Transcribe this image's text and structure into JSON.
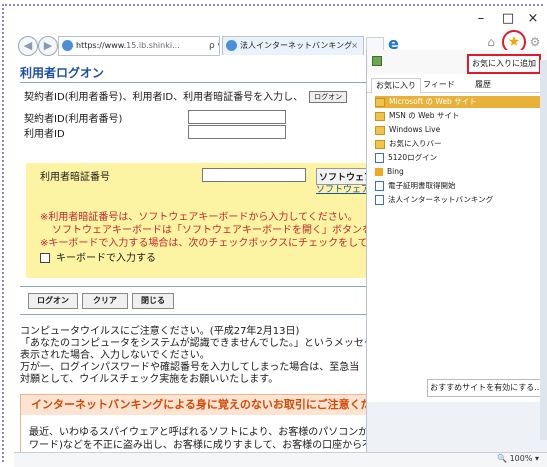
{
  "browser": {
    "url_host": "https://www.",
    "url_rest": "15.ib.shinki...",
    "url_icons": "ρ ▾ 🔒 C",
    "tab_title": "法人インターネットバンキング",
    "tab_close": "×",
    "ie_letter": "e",
    "win_minimize": "–",
    "win_maximize": "□",
    "win_close": "×",
    "star": "★",
    "zoom": "🔍 100%  ▾"
  },
  "page": {
    "title": "利用者ログオン",
    "instruction": "契約者ID(利用者番号)、利用者ID、利用者暗証番号を入力し、",
    "instruction_btn": "ログオン",
    "contract_label": "契約者ID(利用者番号)",
    "user_label": "利用者ID",
    "pin_label": "利用者暗証番号",
    "sw_keyboard_btn": "ソフトウェアキ",
    "sw_keyboard_link": "ソフトウェア",
    "note1": "※利用者暗証番号は、ソフトウェアキーボードから入力してください。",
    "note2": "ソフトウェアキーボードは「ソフトウェアキーボードを開く」ボタンを押して",
    "note3": "※キーボードで入力する場合は、次のチェックボックスにチェックをしてく",
    "checkbox_label": "キーボードで入力する",
    "buttons": {
      "logon": "ログオン",
      "clear": "クリア",
      "close": "閉じる"
    },
    "virus_lines": [
      "コンピュータウイルスにご注意ください。(平成27年2月13日)",
      "「あなたのコンピュータをシステムが認識できませんでした。」というメッセー",
      "表示された場合、入力しないでください。",
      "万が一、ログインパスワードや確認番号を入力してしまった場合は、至急当",
      "対願として、ウイルスチェック実施をお願いいたします。"
    ],
    "warning_title": "インターネットバンキングによる身に覚えのないお取引にご注意ください！",
    "warning_lines": [
      "最近、いわゆるスパイウェアと呼ばれるソフトにより、お客様のパソコンから暗証番号(パス",
      "ワード)などを不正に盗み出し、お客様に成りすまして、お客様の口座から不正に預金を引き"
    ]
  },
  "favorites": {
    "add_button": "お気に入りに追加",
    "add_dropdown": "▾",
    "tabs": [
      "お気に入り",
      "フィード",
      "履歴"
    ],
    "items": [
      {
        "label": "Microsoft の Web サイト",
        "icon": "folder-icon",
        "selected": true
      },
      {
        "label": "MSN の Web サイト",
        "icon": "folder-icon",
        "selected": false
      },
      {
        "label": "Windows Live",
        "icon": "folder-icon",
        "selected": false
      },
      {
        "label": "お気に入りバー",
        "icon": "folder-icon",
        "selected": false
      },
      {
        "label": "5120ログイン",
        "icon": "page-icon",
        "selected": false
      },
      {
        "label": "Bing",
        "icon": "bing-icon",
        "selected": false
      },
      {
        "label": "電子証明書取得開始",
        "icon": "page-icon",
        "selected": false
      },
      {
        "label": "法人インターネットバンキング",
        "icon": "page-icon",
        "selected": false
      }
    ],
    "suggested_button": "おすすめサイトを有効にする..."
  },
  "colors": {
    "accent_red": "#e0192b",
    "title_blue": "#1e4fa6",
    "yellow_panel": "#fdf4a3",
    "selected_item": "#e8b23a"
  }
}
